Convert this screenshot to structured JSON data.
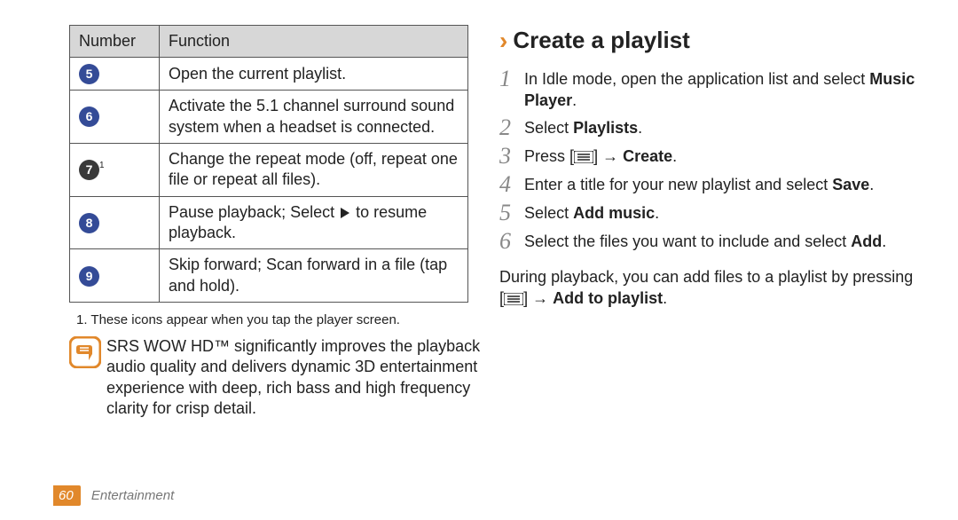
{
  "table": {
    "header_number": "Number",
    "header_function": "Function",
    "rows": [
      {
        "num": "5",
        "sup": "",
        "dark": false,
        "func": "Open the current playlist."
      },
      {
        "num": "6",
        "sup": "",
        "dark": false,
        "func": "Activate the 5.1 channel surround sound system when a headset is connected."
      },
      {
        "num": "7",
        "sup": "1",
        "dark": true,
        "func": "Change the repeat mode (off, repeat one file or repeat all files)."
      },
      {
        "num": "8",
        "sup": "",
        "dark": false,
        "func_html": "Pause playback; Select {PLAY} to resume playback."
      },
      {
        "num": "9",
        "sup": "",
        "dark": false,
        "func": "Skip forward; Scan forward in a file (tap and hold)."
      }
    ]
  },
  "footnote": "1. These icons appear when you tap the player screen.",
  "note": "SRS WOW HD™ significantly improves the playback audio quality and delivers dynamic 3D entertainment experience with deep, rich bass and high frequency clarity for crisp detail.",
  "section_title": "Create a playlist",
  "steps": [
    {
      "n": "1",
      "html": "In Idle mode, open the application list and select <b>Music Player</b>."
    },
    {
      "n": "2",
      "html": "Select <b>Playlists</b>."
    },
    {
      "n": "3",
      "html": "Press [{MENU}] → <b>Create</b>."
    },
    {
      "n": "4",
      "html": "Enter a title for your new playlist and select <b>Save</b>."
    },
    {
      "n": "5",
      "html": "Select <b>Add music</b>."
    },
    {
      "n": "6",
      "html": "Select the files you want to include and select <b>Add</b>."
    }
  ],
  "after_steps": "During playback, you can add files to a playlist by pressing [{MENU}] → <b>Add to playlist</b>.",
  "footer": {
    "page": "60",
    "section": "Entertainment"
  }
}
